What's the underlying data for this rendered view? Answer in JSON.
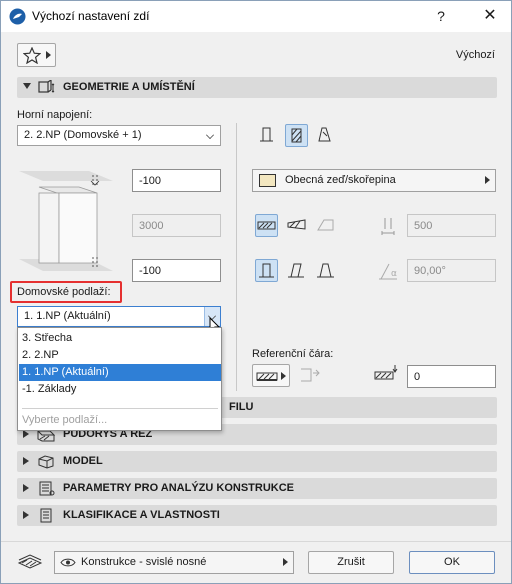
{
  "window": {
    "title": "Výchozí nastavení zdí",
    "help": "?",
    "close": "✕"
  },
  "toolbar": {
    "preset_label": "Výchozí"
  },
  "sections": {
    "geometry": "GEOMETRIE A UMÍSTĚNÍ",
    "profile_partial": "FILU",
    "floorplan": "PŮDORYS A ŘEZ",
    "model": "MODEL",
    "analysis": "PARAMETRY PRO ANALÝZU KONSTRUKCE",
    "classification": "KLASIFIKACE A VLASTNOSTI"
  },
  "geometry": {
    "top_link_label": "Horní napojení:",
    "top_link_value": "2. 2.NP (Domovské + 1)",
    "top_offset": "-100",
    "height": "3000",
    "bottom_offset": "-100",
    "home_story_label": "Domovské podlaží:",
    "home_story_value": "1. 1.NP (Aktuální)",
    "structure_value": "Obecná zeď/skořepina",
    "thickness": "500",
    "angle": "90,00°",
    "ref_line_label": "Referenční čára:",
    "ref_offset": "0"
  },
  "story_dropdown": {
    "options": [
      "3. Střecha",
      "2. 2.NP",
      "1. 1.NP (Aktuální)",
      "-1. Základy"
    ],
    "selected_index": 2,
    "placeholder": "Vyberte podlaží..."
  },
  "footer": {
    "layer_value": "Konstrukce - svislé nosné",
    "cancel": "Zrušit",
    "ok": "OK"
  },
  "colors": {
    "selection": "#2f7fd6",
    "callout": "#e53030",
    "section_bg": "#dadada"
  }
}
